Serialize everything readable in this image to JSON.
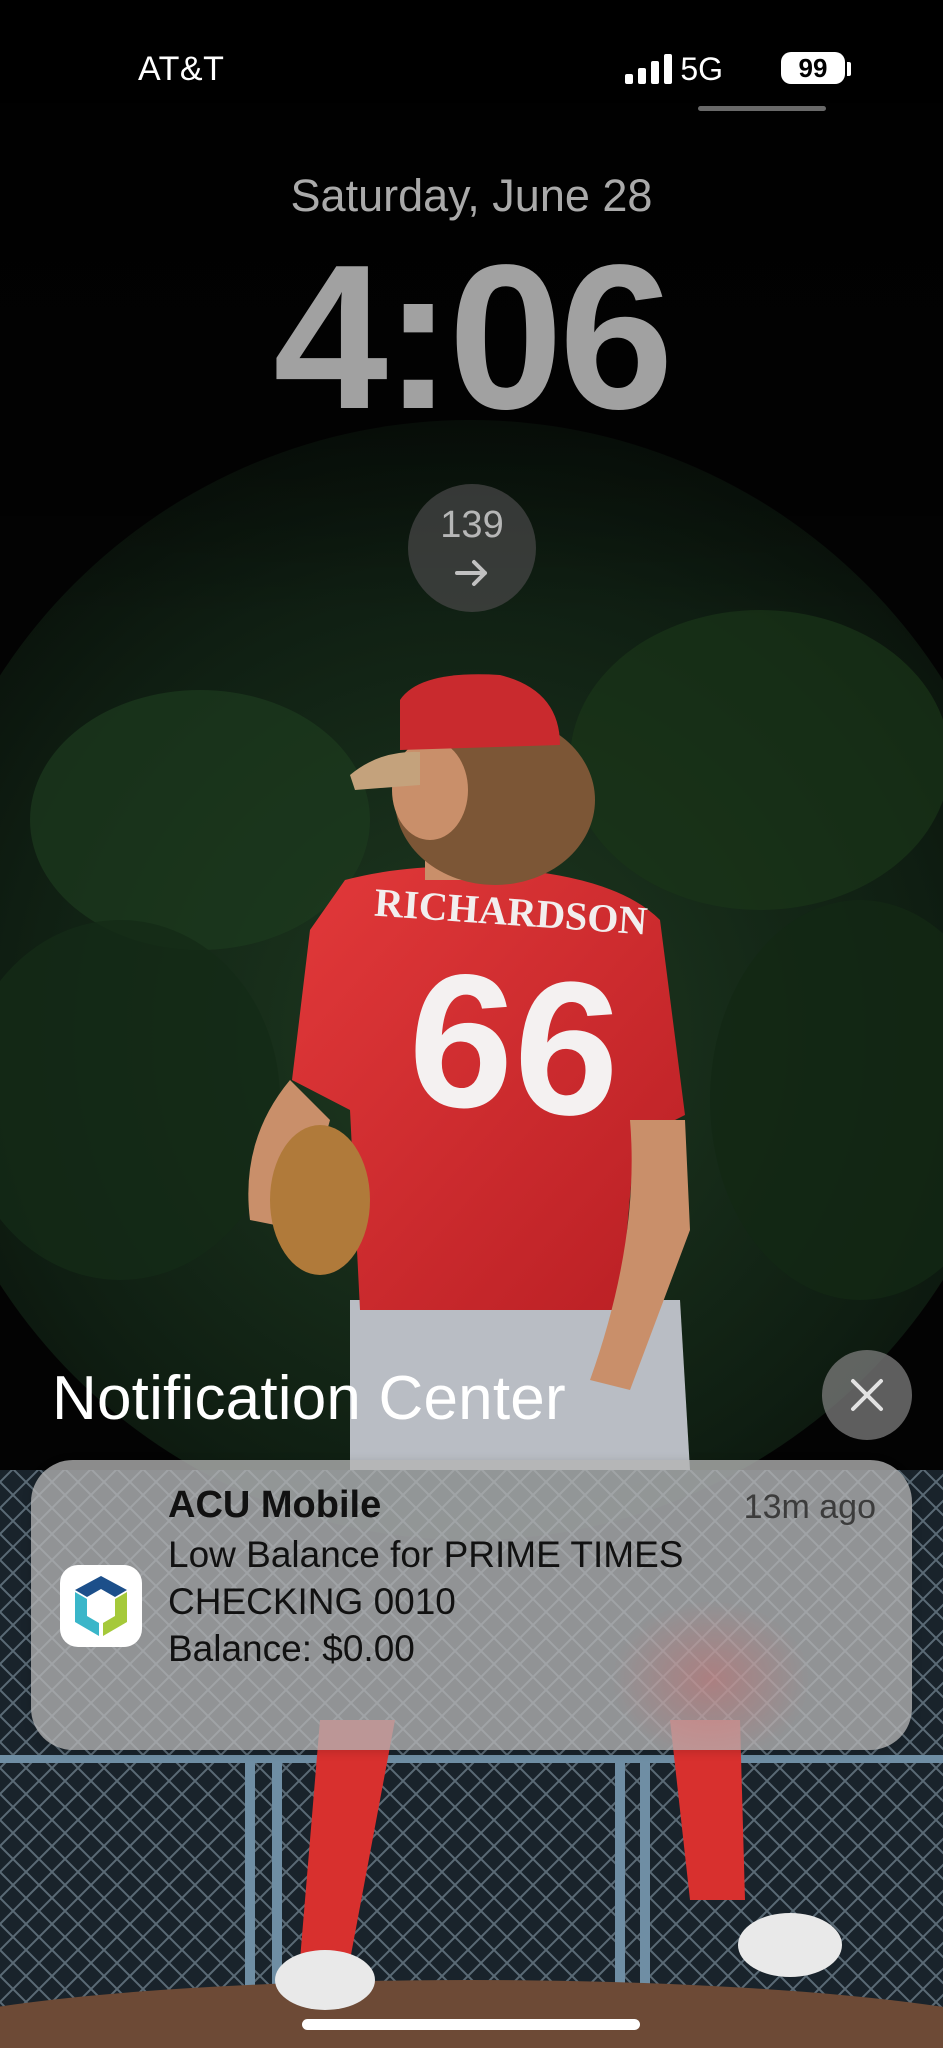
{
  "status_bar": {
    "carrier": "AT&T",
    "network": "5G",
    "battery_level": "99",
    "signal_icon": "cellular-signal-icon",
    "battery_icon": "battery-icon"
  },
  "lock_screen": {
    "date": "Saturday, June 28",
    "time": "4:06",
    "widget": {
      "value": "139",
      "icon": "arrow-right-icon"
    }
  },
  "notification_center": {
    "title": "Notification Center",
    "close_icon": "close-icon",
    "notifications": [
      {
        "app_name": "ACU Mobile",
        "time_ago": "13m ago",
        "app_icon": "acu-mobile-app-icon",
        "lines": [
          "Low Balance for PRIME TIMES",
          "CHECKING 0010",
          "Balance: $0.00"
        ]
      }
    ]
  },
  "wallpaper": {
    "jersey_name": "RICHARDSON",
    "jersey_number": "66"
  },
  "colors": {
    "jersey_red": "#d82a2c",
    "foliage": "#17321a",
    "notification_bg": "#b4b4b4"
  }
}
